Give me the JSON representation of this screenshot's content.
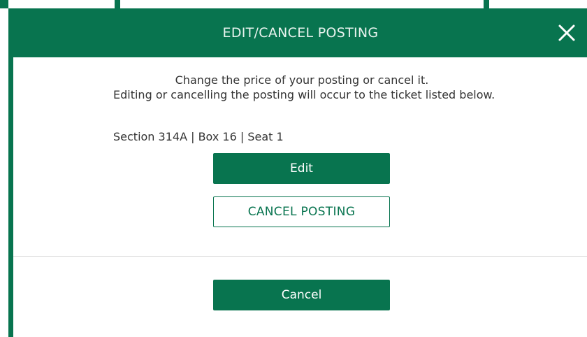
{
  "modal": {
    "title": "EDIT/CANCEL POSTING",
    "close_icon": "close-icon",
    "intro": "Change the price of your posting or cancel it.",
    "explanation": "Editing or cancelling the posting will occur to the ticket listed below.",
    "seat_info": "Section 314A | Box 16 | Seat 1",
    "edit_label": "Edit",
    "cancel_posting_label": "CANCEL POSTING",
    "cancel_label": "Cancel"
  },
  "colors": {
    "brand_green": "#08744f",
    "text": "#333333",
    "divider": "#d9d9d9"
  }
}
